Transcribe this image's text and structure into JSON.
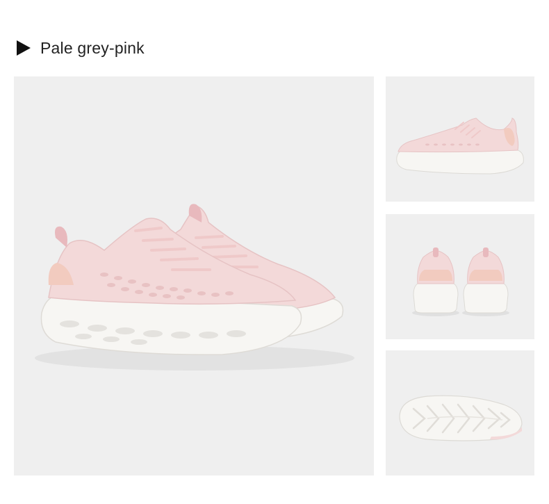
{
  "section": {
    "title": "Pale grey-pink",
    "icon": "play-triangle-icon"
  },
  "colors": {
    "panel_background": "#efefef",
    "upper": "#f3d9d9",
    "upper_shade": "#e8c2c3",
    "accent_peach": "#f2cbbf",
    "sole": "#f7f6f3",
    "sole_shade": "#e2e0dc"
  },
  "gallery": {
    "main_view": "pair-side-angle",
    "thumbnails": [
      "side-profile",
      "heel-pair",
      "outsole"
    ]
  }
}
